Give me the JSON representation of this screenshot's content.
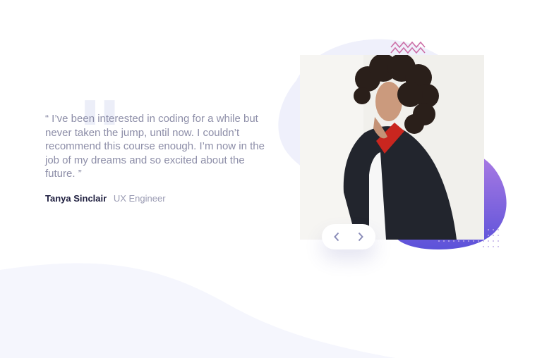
{
  "testimonial": {
    "quote": "“ I’ve been interested in coding for a while but never taken the jump, until now. I couldn’t recommend this course enough. I’m now in the job of my dreams and so excited about the future. ”",
    "author_name": "Tanya Sinclair",
    "author_role": "UX Engineer"
  },
  "slider": {
    "prev_icon": "chevron-left-icon",
    "next_icon": "chevron-right-icon"
  },
  "colors": {
    "accent_gradient_start": "#a87ae3",
    "accent_gradient_end": "#5c52d9",
    "backdrop_blob": "#eff0fb",
    "zigzag": "#cc6ea6",
    "dots": "#c0aee8",
    "author_name": "#202040",
    "text_muted": "#8d8ea8"
  }
}
